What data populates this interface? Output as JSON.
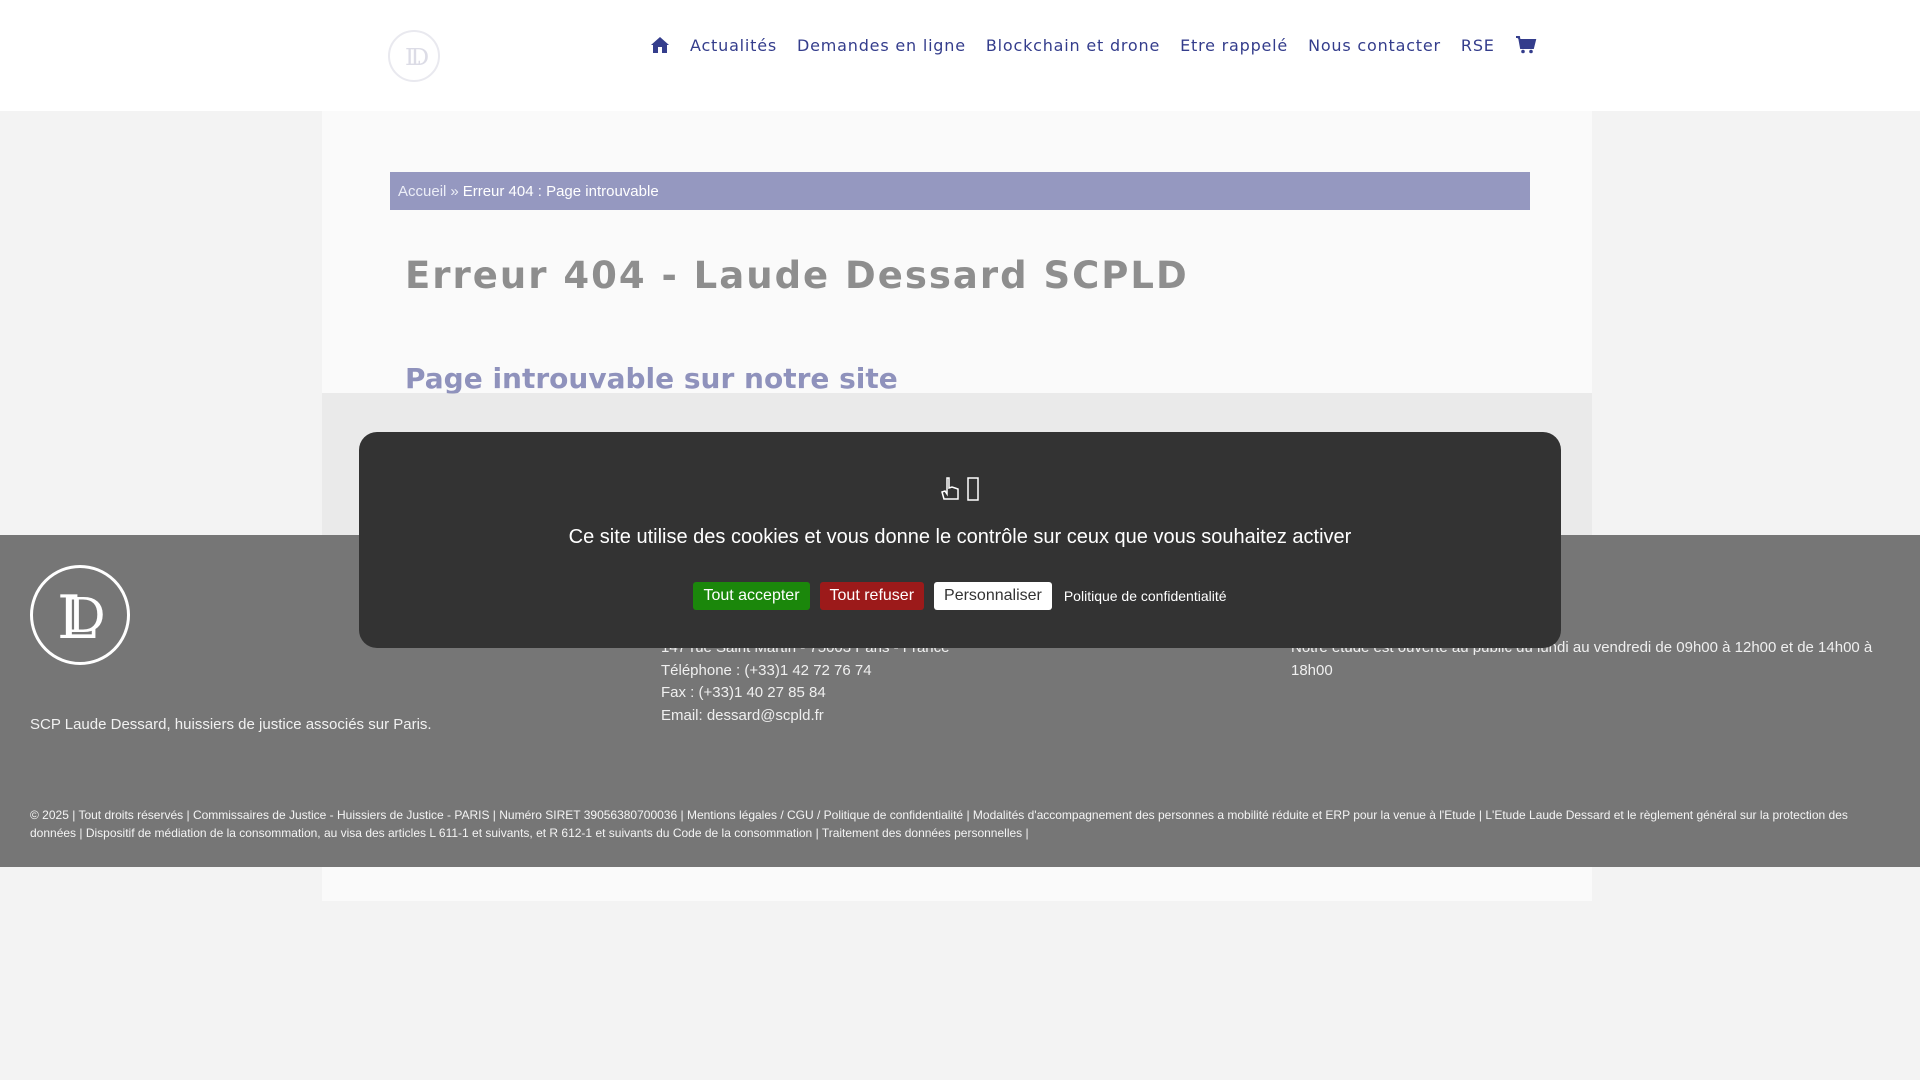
{
  "header": {
    "logo_icon": "ld-logo-icon",
    "nav": [
      {
        "label": "Actualités"
      },
      {
        "label": "Demandes en ligne"
      },
      {
        "label": "Blockchain et drone"
      },
      {
        "label": "Etre rappelé"
      },
      {
        "label": "Nous contacter"
      },
      {
        "label": "RSE"
      }
    ],
    "home_icon": "home-icon",
    "cart_icon": "cart-icon"
  },
  "breadcrumb": {
    "home": "Accueil",
    "separator": "»",
    "current": "Erreur 404 : Page introuvable"
  },
  "main": {
    "title": "Erreur 404 - Laude Dessard SCPLD",
    "subtitle": "Page introuvable sur notre site"
  },
  "cookie_banner": {
    "icons": [
      "hand-pointer-icon",
      "cookie-icon"
    ],
    "text": "Ce site utilise des cookies et vous donne le contrôle sur ceux que vous souhaitez activer",
    "accept_label": "Tout accepter",
    "deny_label": "Tout refuser",
    "customize_label": "Personnaliser",
    "policy_label": "Politique de confidentialité",
    "colors": {
      "accept": "#1b870b",
      "deny": "#9c1a1a"
    }
  },
  "footer": {
    "tagline": "SCP Laude Dessard, huissiers de justice associés sur Paris.",
    "address_lines": [
      "147 rue Saint Martin - 75003 Paris - France",
      "Téléphone : (+33)1 42 72 76 74",
      "Fax : (+33)1 40 27 85 84",
      "Email: dessard@scpld.fr"
    ],
    "hours": "Notre étude est ouverte au public du lundi au vendredi de 09h00 à 12h00 et de 14h00 à 18h00",
    "legal": {
      "copyright": "© 2025 | Tout droits réservés |",
      "links": [
        "Commissaires de Justice - Huissiers de Justice - PARIS",
        "Numéro SIRET 39056380700036",
        "Mentions légales / CGU / Politique de confidentialité",
        "Modalités d'accompagnement des personnes a mobilité réduite et ERP pour la venue à l'Etude",
        "L'Etude Laude Dessard et le règlement général sur la protection des données",
        "Dispositif de médiation de la consommation, au visa des articles L 611-1 et suivants, et R 612-1 et suivants du Code de la consommation",
        "Traitement des données personnelles"
      ],
      "separator": "|"
    }
  },
  "colors": {
    "nav": "#343d8c",
    "breadcrumb_bg": "#9598c0",
    "title": "#8e8e8e",
    "subtitle": "#8f92bc",
    "footer_bg": "#767676",
    "cookie_bg": "#333333"
  }
}
